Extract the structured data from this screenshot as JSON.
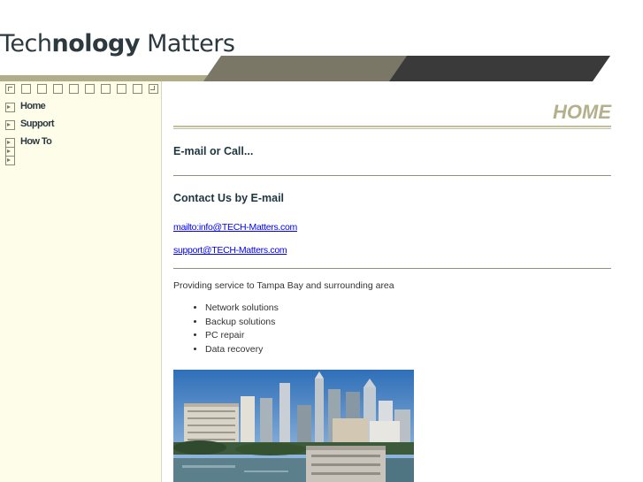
{
  "header": {
    "logo_part1": "Tech",
    "logo_part2": "nology",
    "logo_part3": "Matters",
    "colors": {
      "band_light": "#b0ad8a",
      "band_dark": "#3a3a3a",
      "text": "#2c3a40"
    }
  },
  "sidebar": {
    "background": "#fdfdea",
    "items": [
      {
        "label": "Home"
      },
      {
        "label": "Support"
      },
      {
        "label": "How To"
      },
      {
        "label": ""
      },
      {
        "label": ""
      }
    ]
  },
  "main": {
    "page_title": "HOME",
    "call_heading": "E-mail or Call...",
    "email_heading": "Contact Us by E-mail",
    "links": [
      "mailto:info@TECH-Matters.com",
      "support@TECH-Matters.com"
    ],
    "service_text": "Providing service to Tampa Bay and surrounding area",
    "services": [
      "Network solutions",
      "Backup solutions",
      "PC repair",
      "Data recovery"
    ]
  }
}
